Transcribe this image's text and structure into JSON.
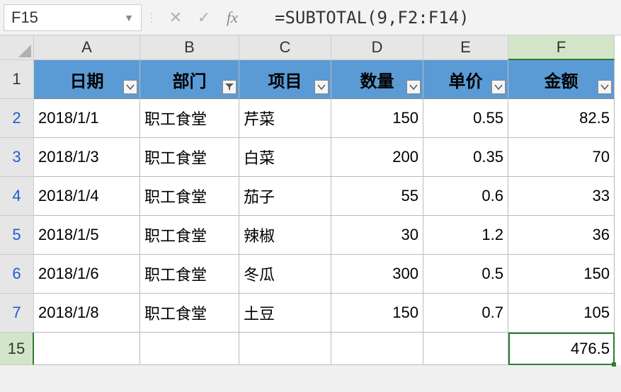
{
  "nameBox": "F15",
  "formula": "=SUBTOTAL(9,F2:F14)",
  "columns": [
    "A",
    "B",
    "C",
    "D",
    "E",
    "F"
  ],
  "headers": {
    "A": "日期",
    "B": "部门",
    "C": "项目",
    "D": "数量",
    "E": "单价",
    "F": "金额"
  },
  "rows": [
    {
      "n": "2",
      "A": "2018/1/1",
      "B": "职工食堂",
      "C": "芹菜",
      "D": "150",
      "E": "0.55",
      "F": "82.5"
    },
    {
      "n": "3",
      "A": "2018/1/3",
      "B": "职工食堂",
      "C": "白菜",
      "D": "200",
      "E": "0.35",
      "F": "70"
    },
    {
      "n": "4",
      "A": "2018/1/4",
      "B": "职工食堂",
      "C": "茄子",
      "D": "55",
      "E": "0.6",
      "F": "33"
    },
    {
      "n": "5",
      "A": "2018/1/5",
      "B": "职工食堂",
      "C": "辣椒",
      "D": "30",
      "E": "1.2",
      "F": "36"
    },
    {
      "n": "6",
      "A": "2018/1/6",
      "B": "职工食堂",
      "C": "冬瓜",
      "D": "300",
      "E": "0.5",
      "F": "150"
    },
    {
      "n": "7",
      "A": "2018/1/8",
      "B": "职工食堂",
      "C": "土豆",
      "D": "150",
      "E": "0.7",
      "F": "105"
    }
  ],
  "totalRow": {
    "n": "15",
    "F": "476.5"
  },
  "selectedCell": "F15",
  "selectedCol": "F",
  "selectedRow": "15"
}
